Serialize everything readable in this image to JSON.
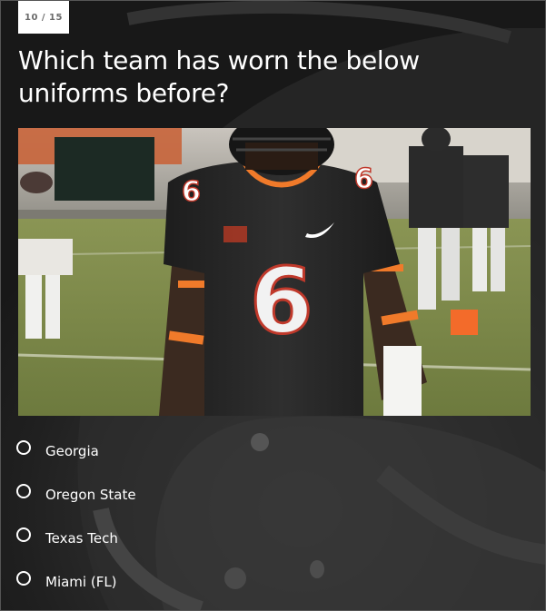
{
  "quiz": {
    "counter": "10 / 15",
    "question": "Which team has worn the below uniforms before?",
    "jersey_number": "6",
    "options": [
      {
        "label": "Georgia"
      },
      {
        "label": "Oregon State"
      },
      {
        "label": "Texas Tech"
      },
      {
        "label": "Miami (FL)"
      }
    ]
  },
  "colors": {
    "background": "#2a2a2a",
    "counter_bg": "#ffffff",
    "text": "#ffffff",
    "jersey": "#262626",
    "accent_orange": "#f07a2a",
    "field_green": "#7d8a4a"
  }
}
